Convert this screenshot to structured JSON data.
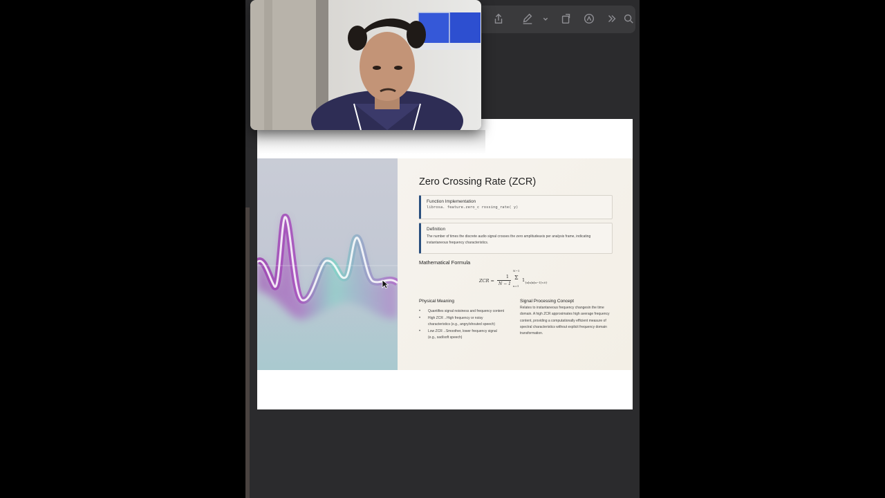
{
  "toolbar": {
    "icons": [
      "share-icon",
      "pen-icon",
      "chevron-down-icon",
      "rotate-icon",
      "markup-icon",
      "more-icon",
      "search-icon"
    ]
  },
  "slide": {
    "title": "Zero Crossing Rate (ZCR)",
    "function_card": {
      "label": "Function Implementation",
      "code": "librosa. feature.zero_c rossing_rate( y)"
    },
    "definition_card": {
      "label": "Definition",
      "text": "The number of times the discrete audio signal crosses the zero amplitudeaxis per analysis frame, indicating instantaneous frequency characteristics."
    },
    "formula_heading": "Mathematical Formula",
    "formula": {
      "lhs": "ZCR =",
      "numerator": "1",
      "denominator": "N − 1",
      "sum_upper": "N−1",
      "sum_symbol": "Σ",
      "sum_lower": "n=1",
      "indicator": "1",
      "indicator_sub": "{x[n]x[n−1]<0}"
    },
    "physical_meaning": {
      "heading": "Physical Meaning",
      "bullets": [
        "Quantifies signal noisiness and frequency content",
        "High ZCR→High frequency or noisy characteristics (e.g., angry/shouted speech)",
        "Low ZCR→Smoother, lower frequency signal (e.g., sad/soft speech)"
      ]
    },
    "signal_concept": {
      "heading": "Signal Processing Concept",
      "text": "Relates to instantaneous frequency changesin the time domain. A high ZCR approximates high average frequency content, providing a computationally efficient measure of spectral characteristics without explicit frequency domain transformation."
    }
  },
  "colors": {
    "accent": "#2a4f7e",
    "toolbar": "#3a3a3c",
    "background": "#2b2b2d"
  }
}
